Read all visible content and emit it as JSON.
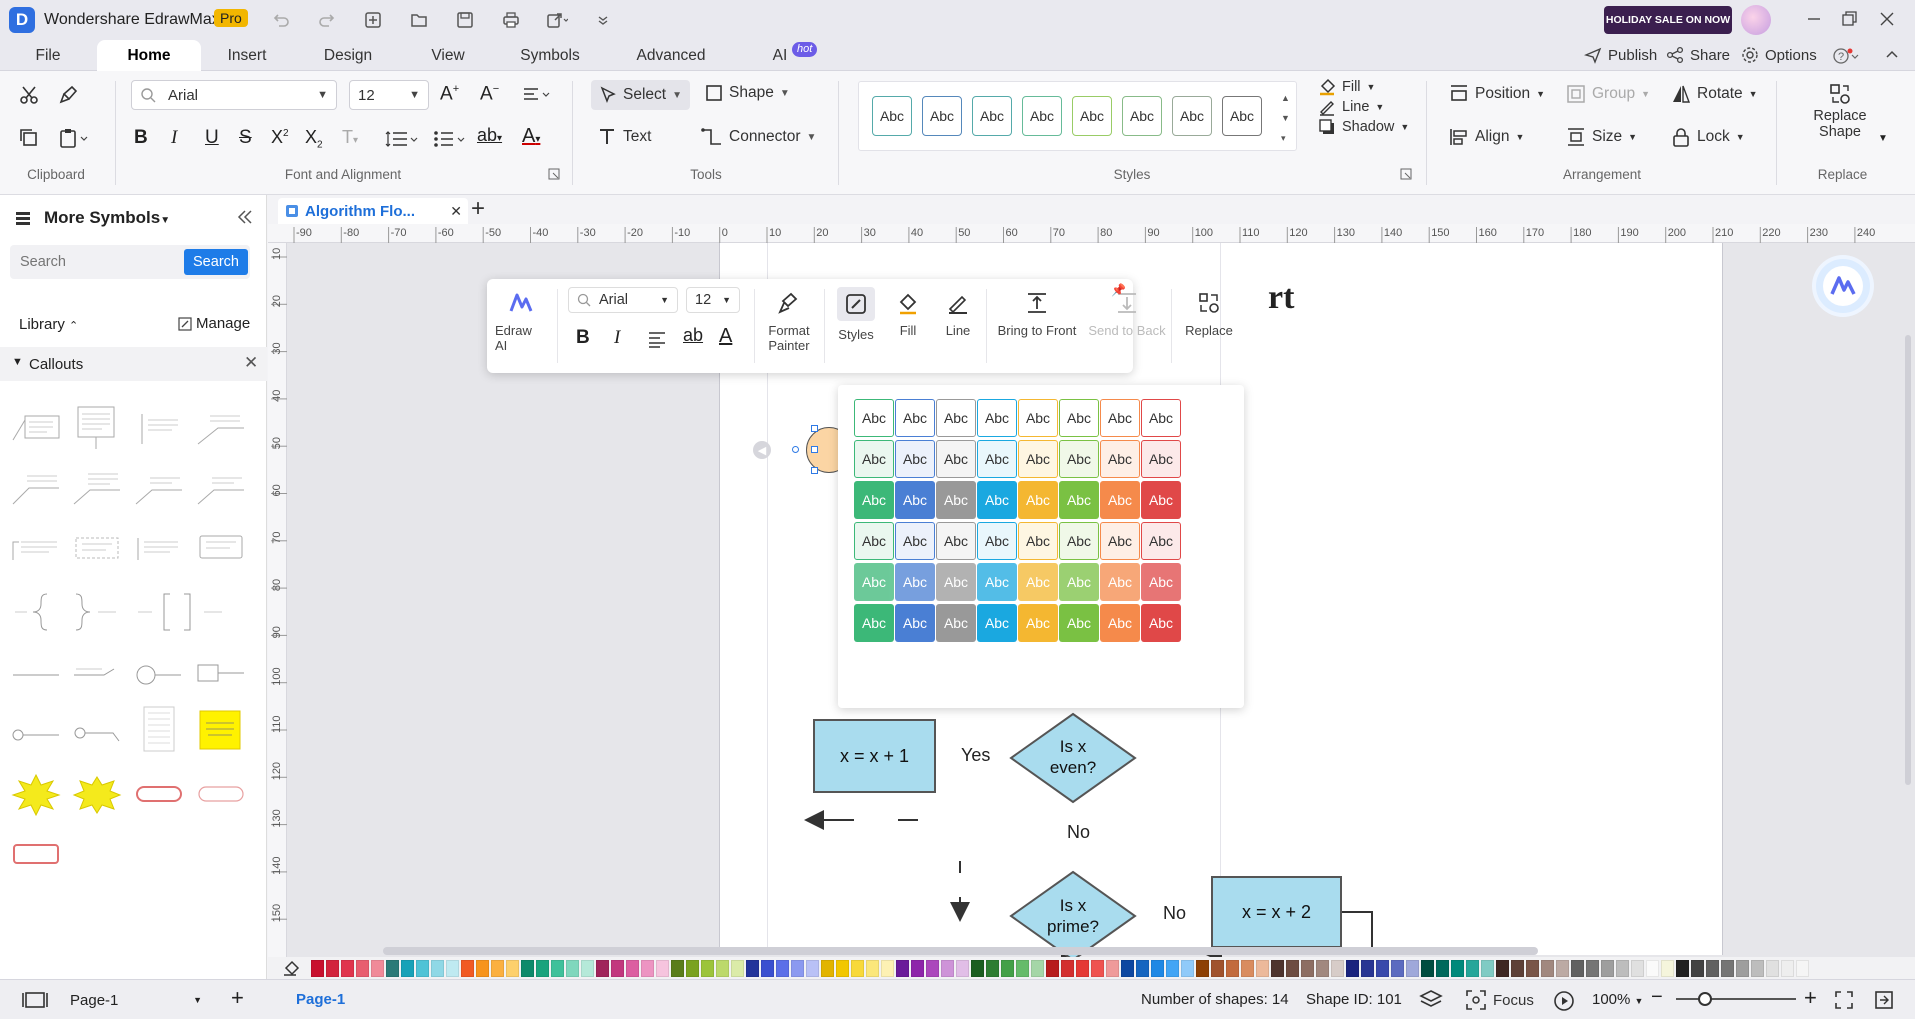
{
  "app": {
    "title": "Wondershare EdrawMax",
    "badge": "Pro",
    "sale": "HOLIDAY SALE ON NOW"
  },
  "menu": {
    "tabs": [
      "File",
      "Home",
      "Insert",
      "Design",
      "View",
      "Symbols",
      "Advanced",
      "AI"
    ],
    "ai_badge": "hot",
    "right": {
      "publish": "Publish",
      "share": "Share",
      "options": "Options"
    }
  },
  "ribbon": {
    "font": {
      "family": "Arial",
      "size": "12"
    },
    "groups": {
      "clipboard": "Clipboard",
      "font": "Font and Alignment",
      "tools": "Tools",
      "styles": "Styles",
      "arrangement": "Arrangement",
      "replace": "Replace"
    },
    "tools": {
      "select": "Select",
      "shape": "Shape",
      "text": "Text",
      "connector": "Connector"
    },
    "style_label": "Abc",
    "fill": "Fill",
    "line": "Line",
    "shadow": "Shadow",
    "arrange": {
      "position": "Position",
      "group": "Group",
      "rotate": "Rotate",
      "align": "Align",
      "size": "Size",
      "lock": "Lock"
    },
    "replace": {
      "line1": "Replace",
      "line2": "Shape"
    }
  },
  "left": {
    "title": "More Symbols",
    "search_placeholder": "Search",
    "search_button": "Search",
    "library": "Library",
    "manage": "Manage",
    "section": "Callouts"
  },
  "doc": {
    "tab": "Algorithm Flo..."
  },
  "ruler": {
    "h": [
      "-90",
      "-80",
      "-70",
      "-60",
      "-50",
      "-40",
      "-30",
      "-20",
      "-10",
      "0",
      "10",
      "20",
      "30",
      "40",
      "50",
      "60",
      "70",
      "80",
      "90",
      "100",
      "110",
      "120",
      "130",
      "140",
      "150",
      "160",
      "170",
      "180",
      "190",
      "200",
      "210",
      "220",
      "230",
      "240"
    ],
    "v": [
      "10",
      "20",
      "30",
      "40",
      "50",
      "60",
      "70",
      "80",
      "90",
      "100",
      "110",
      "120",
      "130",
      "140",
      "150"
    ]
  },
  "popup": {
    "font": "Arial",
    "size": "12",
    "edraw_ai": "Edraw AI",
    "format_painter": [
      "Format",
      "Painter"
    ],
    "styles": "Styles",
    "fill": "Fill",
    "line": "Line",
    "bring_front": "Bring to Front",
    "send_back": "Send to Back",
    "replace": "Replace"
  },
  "palette": {
    "label": "Abc",
    "colors": [
      "#3cb878",
      "#4a7fd4",
      "#999999",
      "#1aa8e0",
      "#f4b731",
      "#7ac143",
      "#f58a4b",
      "#e04848"
    ],
    "light": [
      "#bfe6cf",
      "#c6d6f2",
      "#dedede",
      "#bde6f5",
      "#fde4a8",
      "#d3ebb9",
      "#fbd0b3",
      "#f5bcbc"
    ]
  },
  "flow": {
    "title_fragment": "rt",
    "n1": "x = x + 1",
    "n2": [
      "Is x",
      "even?"
    ],
    "n3": [
      "Is x",
      "prime?"
    ],
    "n4": "x = x + 2",
    "yes": "Yes",
    "no1": "No",
    "no2": "No"
  },
  "status": {
    "page_selector": "Page-1",
    "page_tab": "Page-1",
    "shapes": "Number of shapes: 14",
    "shape_id": "Shape ID: 101",
    "focus": "Focus",
    "zoom": "100%"
  },
  "colorbar": [
    "#c8102e",
    "#d2233c",
    "#e0344d",
    "#e85d6f",
    "#f08a99",
    "#2b7a78",
    "#17a2b8",
    "#4fc3d6",
    "#8fd8e6",
    "#bfeaf1",
    "#f15a24",
    "#f7941d",
    "#fbb040",
    "#fdd06c",
    "#0d8a6b",
    "#19a37d",
    "#3fc19b",
    "#7fd7bd",
    "#b5e9d9",
    "#a0245b",
    "#c2377e",
    "#dc5ea1",
    "#ed94c2",
    "#f6c4de",
    "#5a7d1a",
    "#7aa21f",
    "#9cc43b",
    "#bcd96b",
    "#dbeba8",
    "#23349b",
    "#3a4fd0",
    "#5c6fe8",
    "#8b99f0",
    "#b9c1f6",
    "#e2b400",
    "#f2c700",
    "#f8d93a",
    "#fbe77a",
    "#fdf1b4",
    "#6a1b9a",
    "#8e24aa",
    "#ab47bc",
    "#ce93d8",
    "#e1bee7",
    "#1b5e20",
    "#2e7d32",
    "#43a047",
    "#66bb6a",
    "#a5d6a7",
    "#b71c1c",
    "#d32f2f",
    "#e53935",
    "#ef5350",
    "#ef9a9a",
    "#0d47a1",
    "#1565c0",
    "#1e88e5",
    "#42a5f5",
    "#90caf9",
    "#8d4004",
    "#a0522d",
    "#c26a3d",
    "#d98c5f",
    "#ecb99b",
    "#4e342e",
    "#6d4c41",
    "#8d6e63",
    "#a1887f",
    "#d7ccc8",
    "#1a237e",
    "#283593",
    "#3949ab",
    "#5c6bc0",
    "#9fa8da",
    "#004d40",
    "#00695c",
    "#00897b",
    "#26a69a",
    "#80cbc4",
    "#3e2723",
    "#5d4037",
    "#795548",
    "#a1887f",
    "#bcaaa4",
    "#616161",
    "#757575",
    "#9e9e9e",
    "#bdbdbd",
    "#e0e0e0",
    "#fafafa",
    "#f5f5dc",
    "#212121",
    "#424242",
    "#616161",
    "#757575",
    "#9e9e9e",
    "#bdbdbd",
    "#e0e0e0",
    "#eeeeee",
    "#f5f5f5",
    "#ffffff"
  ]
}
